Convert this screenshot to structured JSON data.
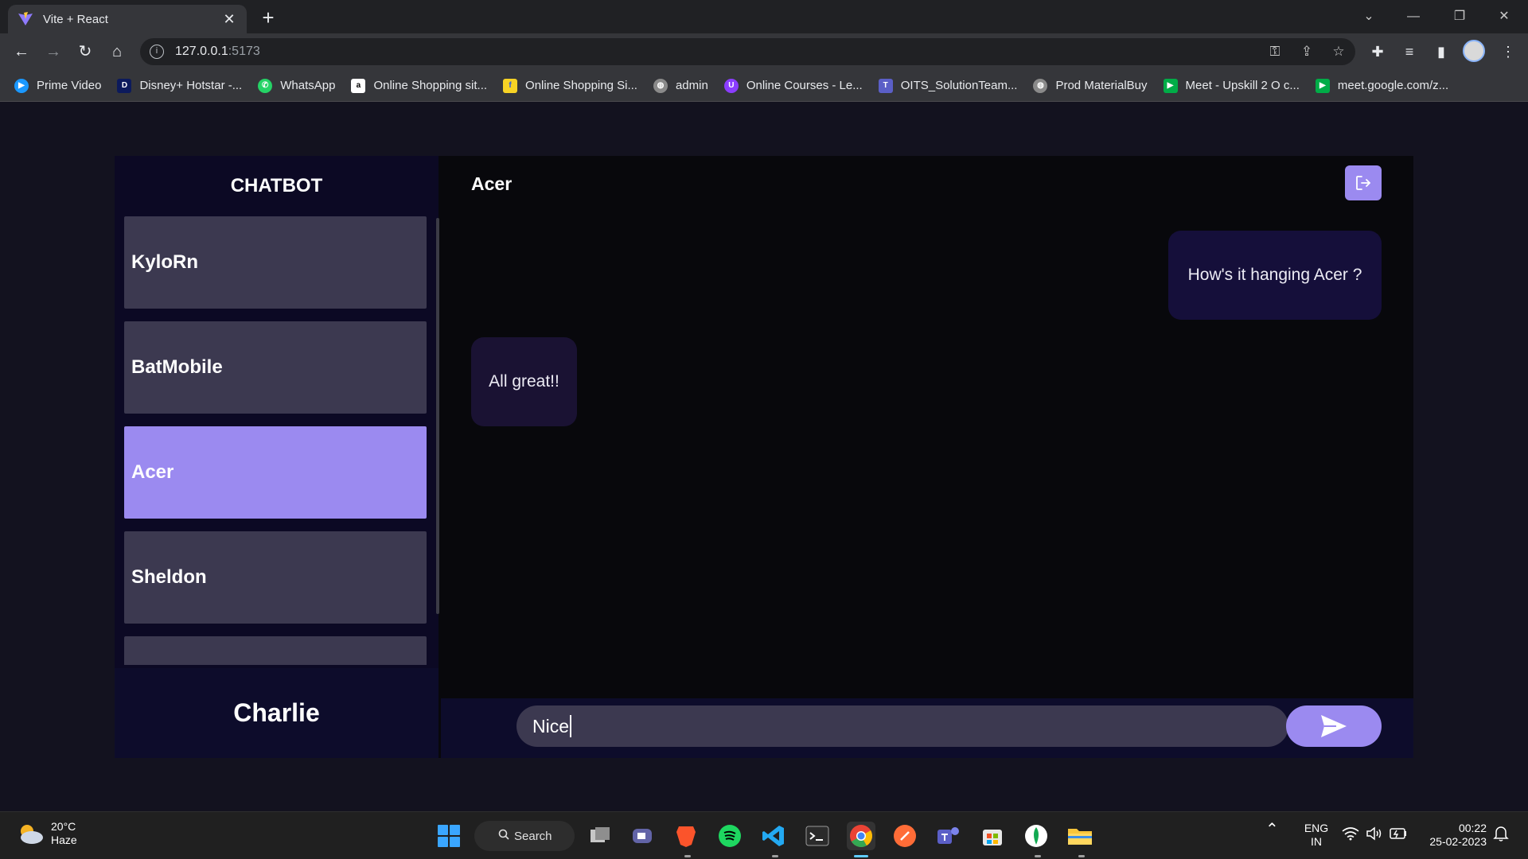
{
  "browser": {
    "tab_title": "Vite + React",
    "url_host": "127.0.0.1",
    "url_port": ":5173",
    "bookmarks": [
      {
        "label": "Prime Video",
        "color": "#1a98ff"
      },
      {
        "label": "Disney+ Hotstar -...",
        "color": "#0c1a5c"
      },
      {
        "label": "WhatsApp",
        "color": "#25d366"
      },
      {
        "label": "Online Shopping sit...",
        "color": "#ffffff"
      },
      {
        "label": "Online Shopping Si...",
        "color": "#f7d325"
      },
      {
        "label": "admin",
        "color": "#8a8a8a"
      },
      {
        "label": "Online Courses - Le...",
        "color": "#8b3dff"
      },
      {
        "label": "OITS_SolutionTeam...",
        "color": "#5b5fc7"
      },
      {
        "label": "Prod MaterialBuy",
        "color": "#8a8a8a"
      },
      {
        "label": "Meet - Upskill 2 O c...",
        "color": "#00ac47"
      },
      {
        "label": "meet.google.com/z...",
        "color": "#00ac47"
      }
    ]
  },
  "app": {
    "sidebar_title": "CHATBOT",
    "contacts": [
      {
        "name": "KyloRn"
      },
      {
        "name": "BatMobile"
      },
      {
        "name": "Acer"
      },
      {
        "name": "Sheldon"
      },
      {
        "name": ""
      }
    ],
    "active_contact": "Acer",
    "current_user": "Charlie",
    "chat_header": "Acer",
    "messages": [
      {
        "from": "me",
        "text": "How's it hanging Acer ?"
      },
      {
        "from": "them",
        "text": "All great!!"
      }
    ],
    "input_value": "Nice",
    "accent_color": "#9b8af0"
  },
  "taskbar": {
    "weather_temp": "20°C",
    "weather_desc": "Haze",
    "search_label": "Search",
    "lang_line1": "ENG",
    "lang_line2": "IN",
    "time": "00:22",
    "date": "25-02-2023"
  }
}
